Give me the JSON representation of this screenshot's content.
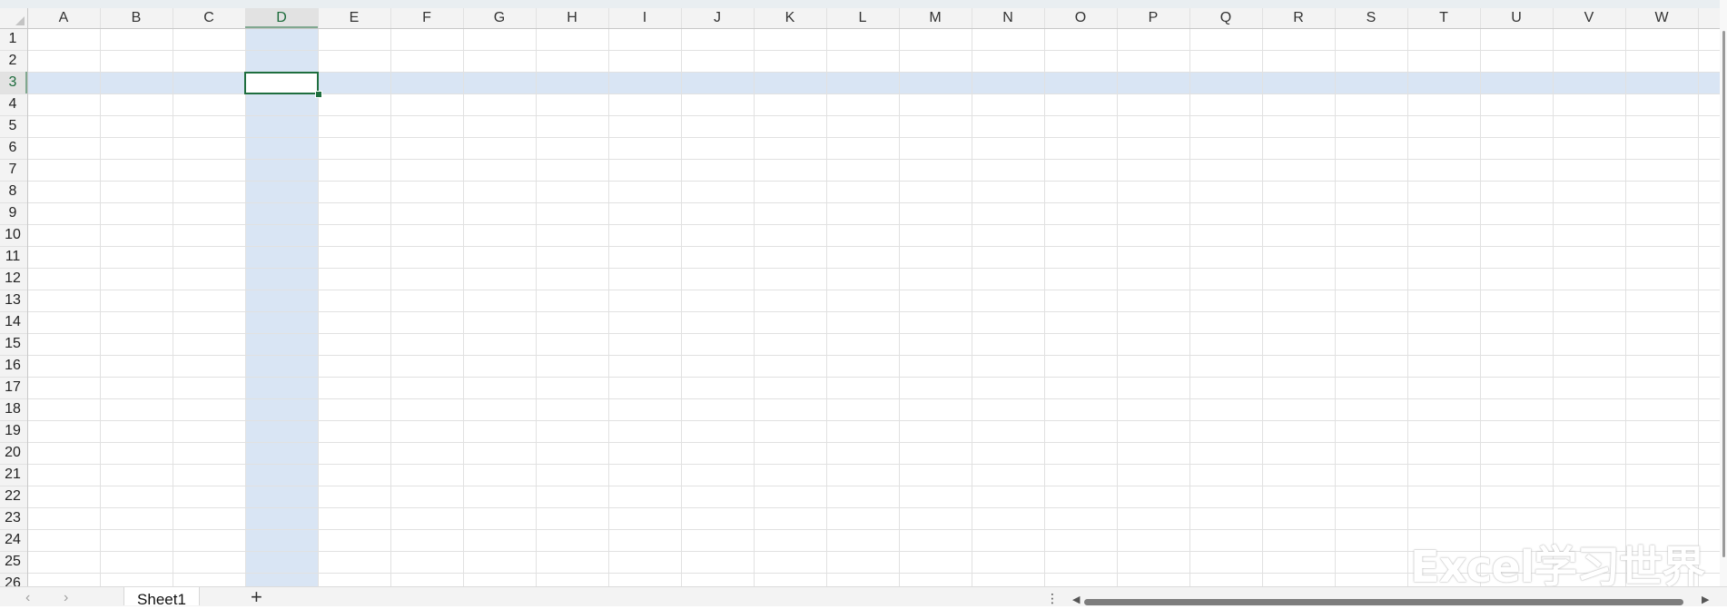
{
  "sheet": {
    "columns": [
      "A",
      "B",
      "C",
      "D",
      "E",
      "F",
      "G",
      "H",
      "I",
      "J",
      "K",
      "L",
      "M",
      "N",
      "O",
      "P",
      "Q",
      "R",
      "S",
      "T",
      "U",
      "V",
      "W"
    ],
    "rows": [
      "1",
      "2",
      "3",
      "4",
      "5",
      "6",
      "7",
      "8",
      "9",
      "10",
      "11",
      "12",
      "13",
      "14",
      "15",
      "16",
      "17",
      "18",
      "19",
      "20",
      "21",
      "22",
      "23",
      "24",
      "25",
      "26"
    ],
    "active_cell": {
      "column": "D",
      "row": "3"
    },
    "colors": {
      "selection_highlight": "#d9e5f4",
      "active_border": "#1e6e3e",
      "grid_line": "#e1e1e1",
      "header_bg": "#f3f3f3"
    }
  },
  "tabs": {
    "sheet_names": [
      "Sheet1"
    ],
    "add_sheet_label": "+",
    "prev_icon": "chevron-left-icon",
    "next_icon": "chevron-right-icon"
  },
  "watermark": "Excel学习世界"
}
